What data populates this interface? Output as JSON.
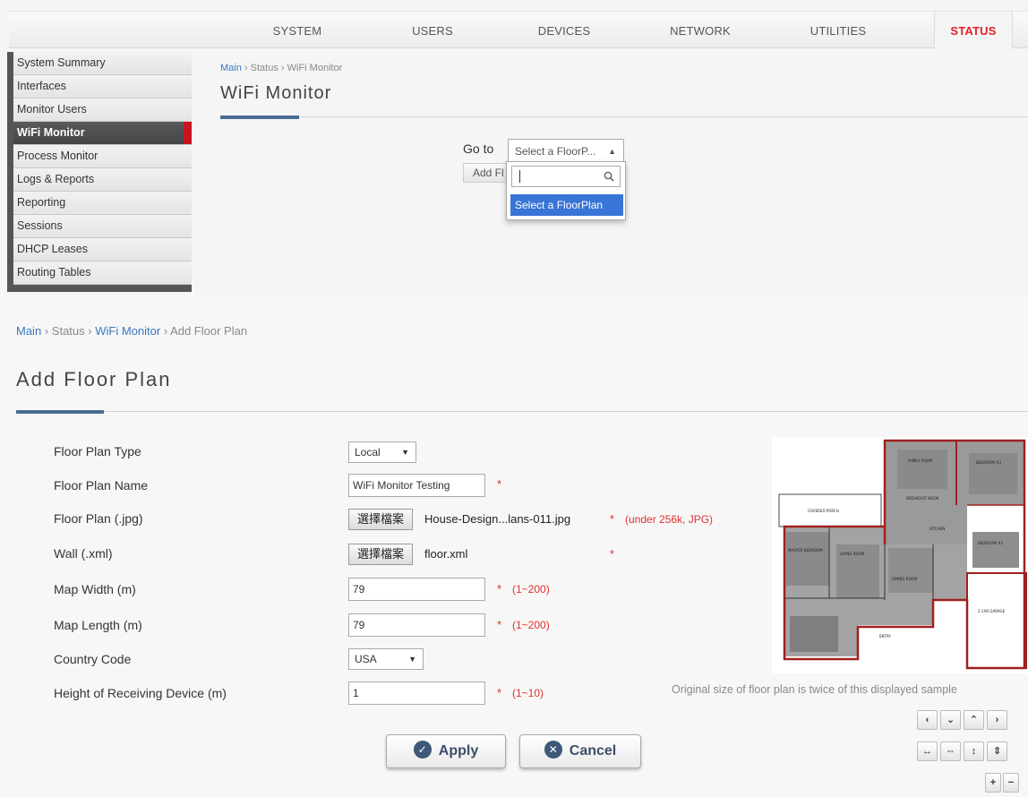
{
  "nav": {
    "tabs": [
      "SYSTEM",
      "USERS",
      "DEVICES",
      "NETWORK",
      "UTILITIES",
      "STATUS"
    ],
    "active": "STATUS"
  },
  "sidebar": {
    "items": [
      "System Summary",
      "Interfaces",
      "Monitor Users",
      "WiFi Monitor",
      "Process Monitor",
      "Logs & Reports",
      "Reporting",
      "Sessions",
      "DHCP Leases",
      "Routing Tables"
    ],
    "active": "WiFi Monitor"
  },
  "top": {
    "breadcrumb": {
      "main": "Main",
      "status": "Status",
      "current": "WiFi Monitor",
      "sep": "›"
    },
    "title": "WiFi Monitor",
    "goto_label": "Go to",
    "select_value": "Select a FloorP...",
    "search_value": "",
    "option": "Select a FloorPlan",
    "add_button": "Add Fl"
  },
  "page": {
    "breadcrumb": {
      "main": "Main",
      "status": "Status",
      "wifi": "WiFi Monitor",
      "current": "Add Floor Plan",
      "sep": "›"
    },
    "title": "Add Floor Plan"
  },
  "form": {
    "type_label": "Floor Plan Type",
    "type_value": "Local",
    "name_label": "Floor Plan Name",
    "name_value": "WiFi Monitor Testing",
    "plan_label": "Floor Plan (.jpg)",
    "choose_file": "選擇檔案",
    "plan_file": "House-Design...lans-011.jpg",
    "plan_hint": "(under 256k, JPG)",
    "wall_label": "Wall (.xml)",
    "wall_file": "floor.xml",
    "width_label": "Map Width (m)",
    "width_value": "79",
    "width_hint": "(1~200)",
    "length_label": "Map Length (m)",
    "length_value": "79",
    "length_hint": "(1~200)",
    "country_label": "Country Code",
    "country_value": "USA",
    "height_label": "Height of Receiving Device (m)",
    "height_value": "1",
    "height_hint": "(1~10)",
    "required_mark": "*"
  },
  "preview": {
    "caption": "Original size of floor plan is twice of this displayed sample",
    "rooms": [
      "FAMILY ROOM",
      "BEDROOM #3",
      "BREAKFAST NOOK",
      "COVERED PORCH",
      "KITCHEN",
      "BEDROOM #2",
      "MASTER BEDROOM",
      "LIVING ROOM",
      "DINING ROOM",
      "2 CAR GARAGE",
      "ENTRY"
    ]
  },
  "controls": {
    "left": "‹",
    "down": "⌄",
    "up": "⌃",
    "right": "›",
    "h_expand": "↔",
    "h_shrink": "⇔",
    "v_expand": "↕",
    "v_shrink": "⇕",
    "zoom_in": "+",
    "zoom_out": "−"
  },
  "actions": {
    "apply": "Apply",
    "cancel": "Cancel"
  }
}
